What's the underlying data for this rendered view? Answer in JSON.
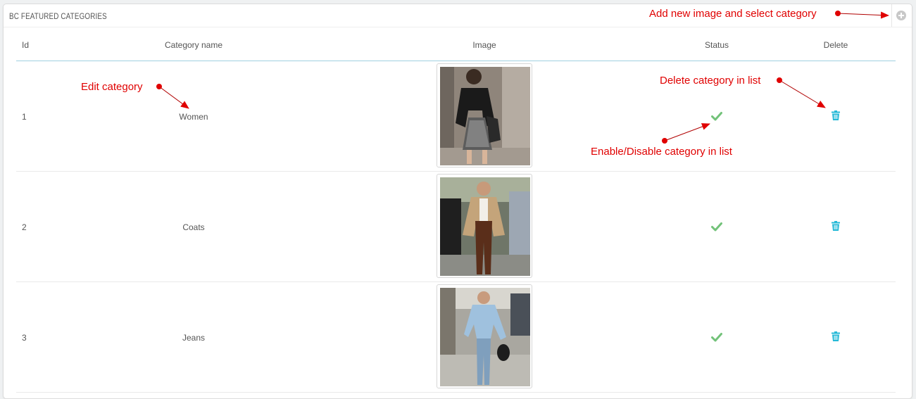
{
  "panel": {
    "title": "BC FEATURED CATEGORIES"
  },
  "table": {
    "columns": {
      "id": "Id",
      "name": "Category name",
      "image": "Image",
      "status": "Status",
      "delete": "Delete"
    },
    "rows": [
      {
        "id": "1",
        "name": "Women",
        "status": "enabled",
        "image_alt": "women-photo"
      },
      {
        "id": "2",
        "name": "Coats",
        "status": "enabled",
        "image_alt": "coats-photo"
      },
      {
        "id": "3",
        "name": "Jeans",
        "status": "enabled",
        "image_alt": "jeans-photo"
      }
    ]
  },
  "annotations": {
    "add": "Add new image and select category",
    "edit": "Edit category",
    "delete": "Delete category in list",
    "toggle": "Enable/Disable category in list"
  },
  "colors": {
    "accent": "#25b9d7",
    "check": "#72c279",
    "annotation": "#e00000",
    "header_line": "#a0d0e0"
  },
  "icons": {
    "add": "plus-circle-icon",
    "status": "check-icon",
    "delete": "trash-icon"
  }
}
